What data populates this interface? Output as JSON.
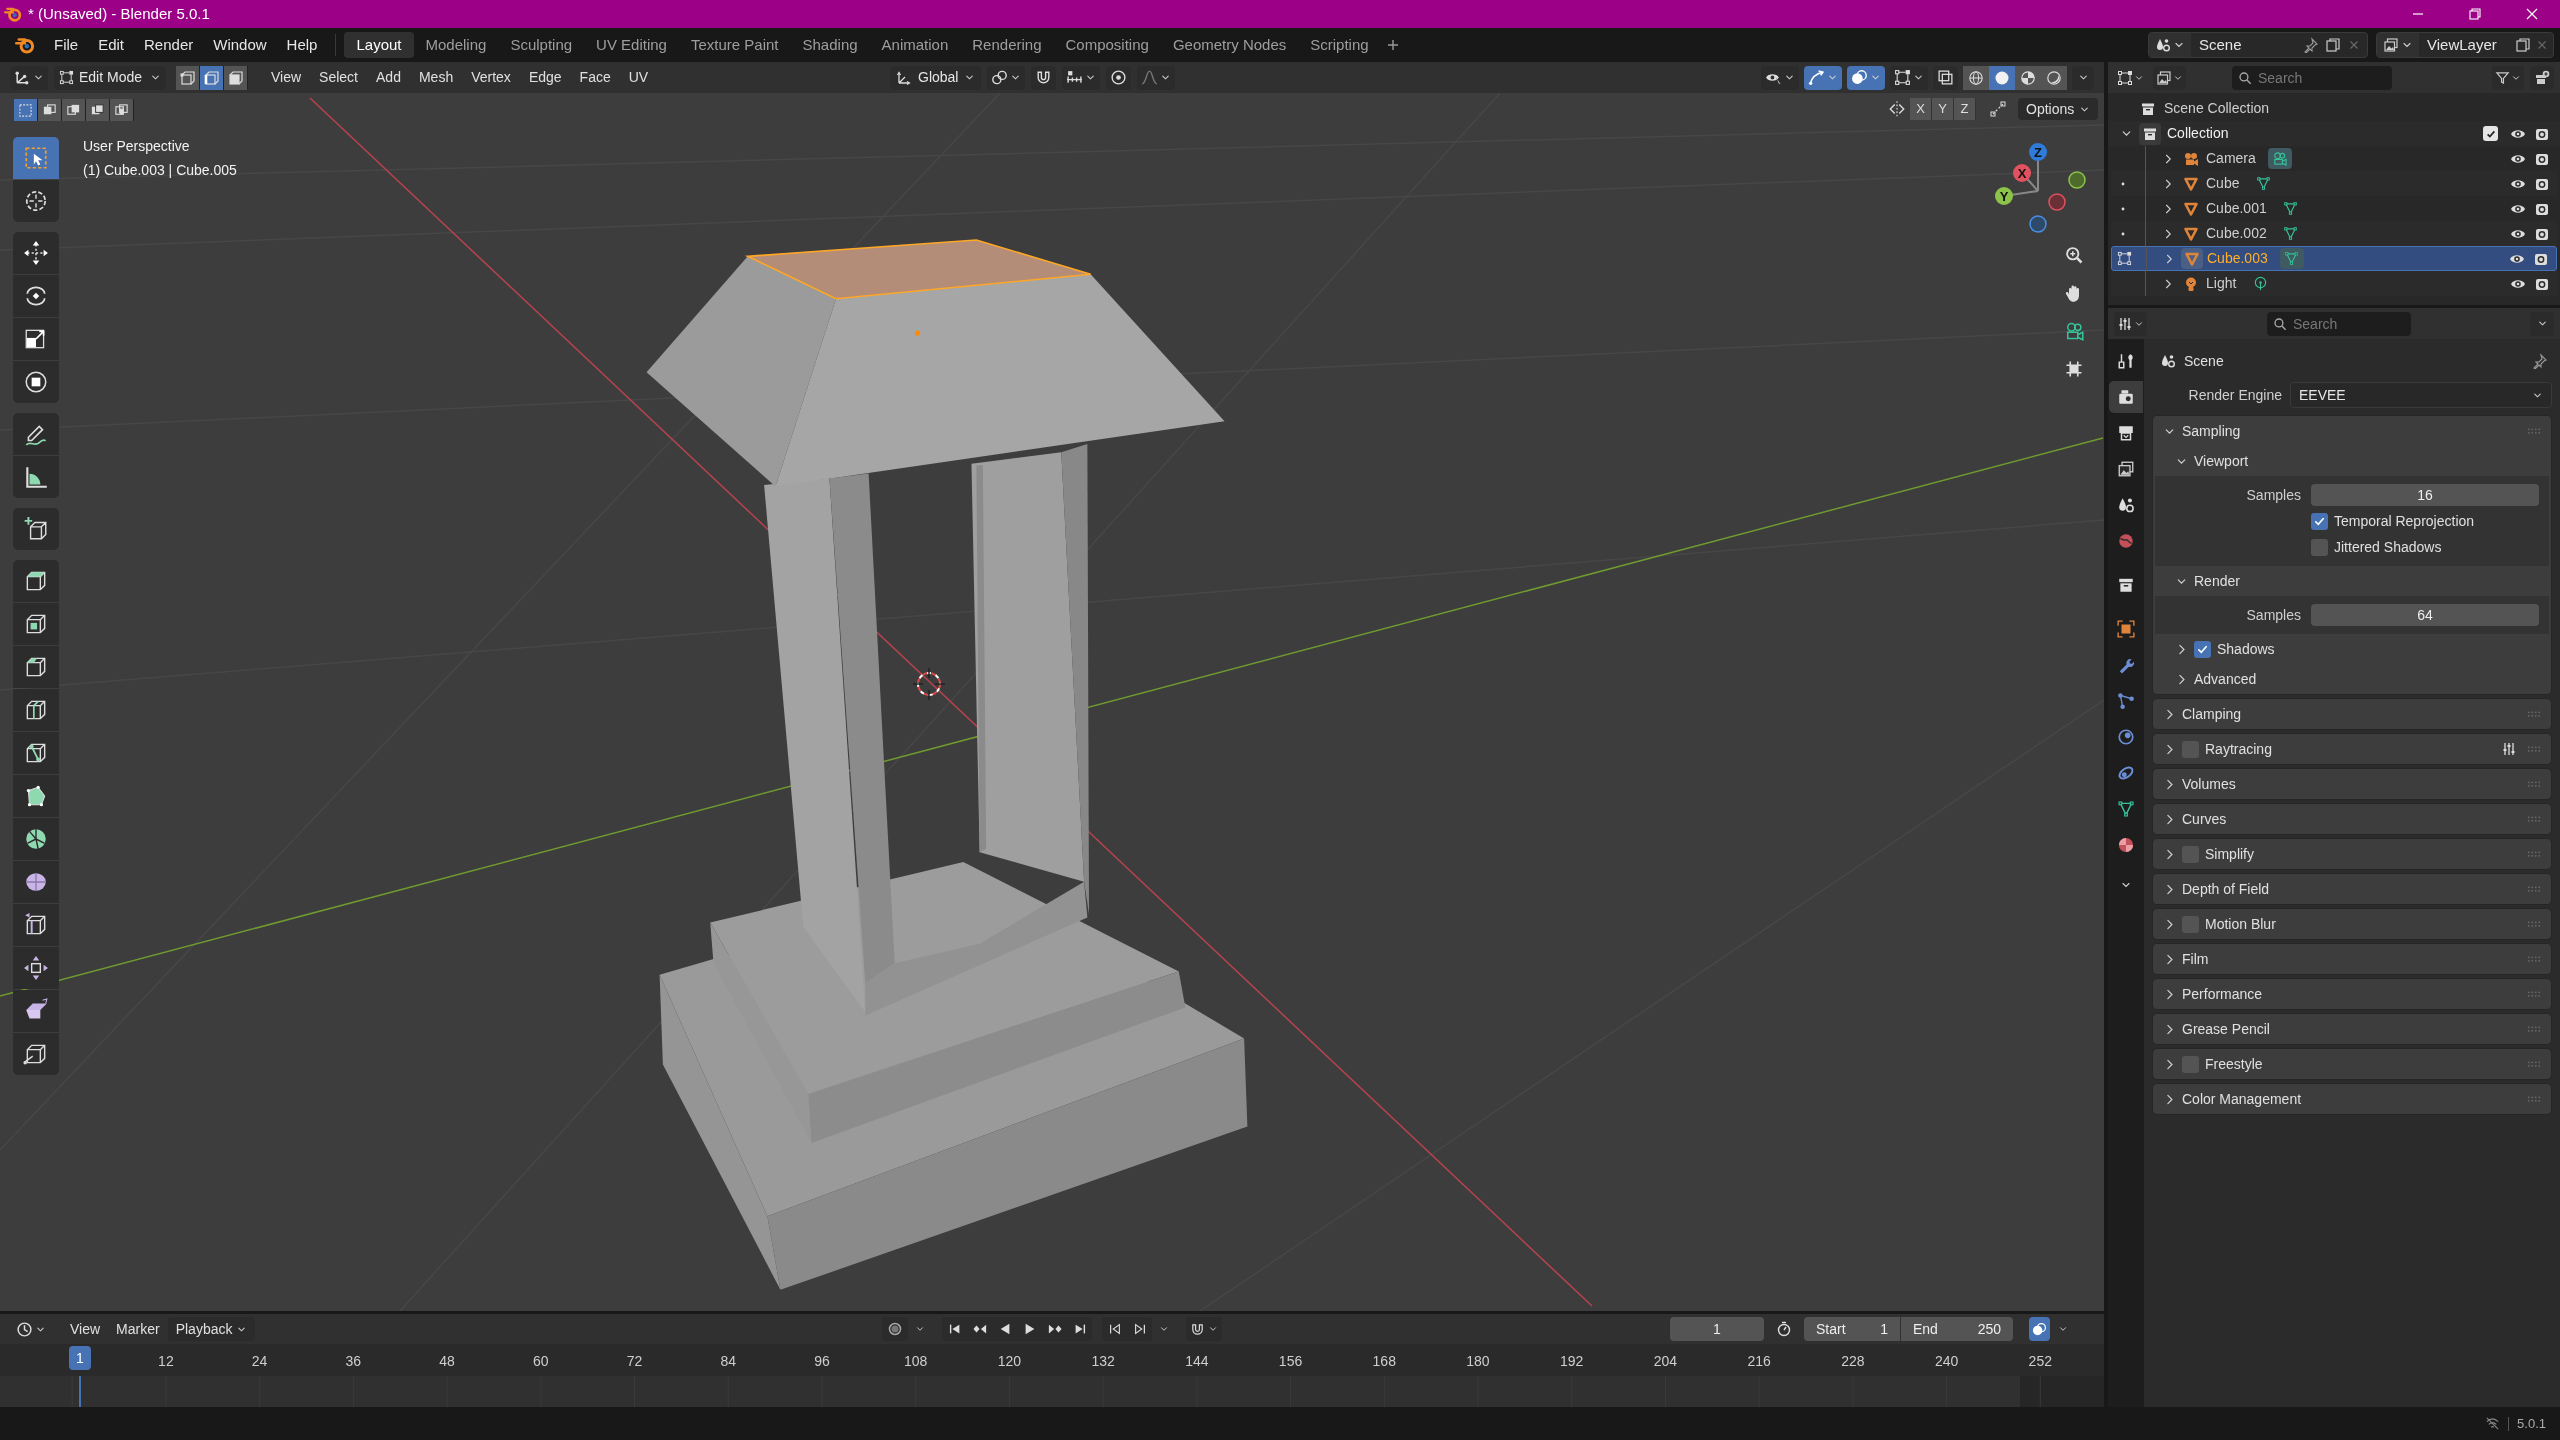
{
  "window": {
    "title": "* (Unsaved) - Blender 5.0.1"
  },
  "menu": [
    "File",
    "Edit",
    "Render",
    "Window",
    "Help"
  ],
  "workspaces": [
    {
      "label": "Layout",
      "selected": true
    },
    {
      "label": "Modeling",
      "selected": false
    },
    {
      "label": "Sculpting",
      "selected": false
    },
    {
      "label": "UV Editing",
      "selected": false
    },
    {
      "label": "Texture Paint",
      "selected": false
    },
    {
      "label": "Shading",
      "selected": false
    },
    {
      "label": "Animation",
      "selected": false
    },
    {
      "label": "Rendering",
      "selected": false
    },
    {
      "label": "Compositing",
      "selected": false
    },
    {
      "label": "Geometry Nodes",
      "selected": false
    },
    {
      "label": "Scripting",
      "selected": false
    }
  ],
  "scene": "Scene",
  "view_layer": "ViewLayer",
  "viewport": {
    "mode": "Edit Mode",
    "select_modes": [
      {
        "selected": false
      },
      {
        "selected": true
      },
      {
        "selected": false
      }
    ],
    "menus": [
      "View",
      "Select",
      "Add",
      "Mesh",
      "Vertex",
      "Edge",
      "Face",
      "UV"
    ],
    "orientation": "Global",
    "snap": false,
    "proportional_editing": false,
    "gizmos": true,
    "overlays": true,
    "xray": false,
    "shading": [
      {
        "selected": false
      },
      {
        "selected": true
      },
      {
        "selected": false
      },
      {
        "selected": false
      }
    ],
    "box_select_modes": [
      {
        "selected": true
      },
      {
        "selected": false
      },
      {
        "selected": false
      },
      {
        "selected": false
      },
      {
        "selected": false
      }
    ],
    "mirror_axes": [
      "X",
      "Y",
      "Z"
    ],
    "options": "Options",
    "view_name": "User Perspective",
    "object_info": "(1) Cube.003 | Cube.005",
    "gizmo_axes": [
      "X",
      "Y",
      "Z"
    ],
    "tool_groups": [
      [
        {
          "selected": true
        },
        {
          "selected": false
        }
      ],
      [
        {
          "selected": false
        },
        {
          "selected": false
        },
        {
          "selected": false
        },
        {
          "selected": false
        }
      ],
      [
        {
          "selected": false
        },
        {
          "selected": false
        }
      ],
      [
        {
          "selected": false
        }
      ],
      [
        {
          "selected": false
        },
        {
          "selected": false
        },
        {
          "selected": false
        },
        {
          "selected": false
        },
        {
          "selected": false
        },
        {
          "selected": false
        },
        {
          "selected": false
        },
        {
          "selected": false
        },
        {
          "selected": false
        },
        {
          "selected": false
        },
        {
          "selected": false
        },
        {
          "selected": false
        }
      ]
    ]
  },
  "outliner": {
    "search_placeholder": "Search",
    "root": "Scene Collection",
    "collection": {
      "name": "Collection",
      "expanded": true,
      "checked": true,
      "items": [
        {
          "name": "Camera",
          "kind": "camera",
          "selected": false,
          "editable": false,
          "editing": false
        },
        {
          "name": "Cube",
          "kind": "mesh",
          "selected": false,
          "editable": true,
          "editing": false
        },
        {
          "name": "Cube.001",
          "kind": "mesh",
          "selected": false,
          "editable": true,
          "editing": false
        },
        {
          "name": "Cube.002",
          "kind": "mesh",
          "selected": false,
          "editable": true,
          "editing": false
        },
        {
          "name": "Cube.003",
          "kind": "mesh",
          "selected": true,
          "editable": true,
          "editing": true
        },
        {
          "name": "Light",
          "kind": "light",
          "selected": false,
          "editable": false,
          "editing": false
        }
      ]
    }
  },
  "properties": {
    "search_placeholder": "Search",
    "tabs": [
      {
        "selected": false
      },
      {
        "selected": true
      },
      {
        "selected": false
      },
      {
        "selected": false
      },
      {
        "selected": false
      },
      {
        "selected": false
      },
      {
        "selected": false
      },
      {
        "selected": false
      },
      {
        "selected": false
      },
      {
        "selected": false
      },
      {
        "selected": false
      },
      {
        "selected": false
      },
      {
        "selected": false
      },
      {
        "selected": false
      }
    ],
    "context": "Scene",
    "render_engine_label": "Render Engine",
    "render_engine": "EEVEE",
    "panels": [
      {
        "title": "Sampling",
        "expanded": true,
        "subpanels": [
          {
            "title": "Viewport",
            "expanded": true,
            "fields": [
              {
                "kind": "number",
                "label": "Samples",
                "value": "16"
              },
              {
                "kind": "checkbox",
                "label": "Temporal Reprojection",
                "checked": true
              },
              {
                "kind": "checkbox",
                "label": "Jittered Shadows",
                "checked": false
              }
            ]
          },
          {
            "title": "Render",
            "expanded": true,
            "fields": [
              {
                "kind": "number",
                "label": "Samples",
                "value": "64"
              }
            ]
          },
          {
            "title": "Shadows",
            "expanded": false,
            "checked": true
          },
          {
            "title": "Advanced",
            "expanded": false
          }
        ]
      },
      {
        "title": "Clamping",
        "expanded": false
      },
      {
        "title": "Raytracing",
        "expanded": false,
        "checked": false,
        "options_icon": true
      },
      {
        "title": "Volumes",
        "expanded": false
      },
      {
        "title": "Curves",
        "expanded": false
      },
      {
        "title": "Simplify",
        "expanded": false,
        "checked": false
      },
      {
        "title": "Depth of Field",
        "expanded": false
      },
      {
        "title": "Motion Blur",
        "expanded": false,
        "checked": false
      },
      {
        "title": "Film",
        "expanded": false
      },
      {
        "title": "Performance",
        "expanded": false
      },
      {
        "title": "Grease Pencil",
        "expanded": false
      },
      {
        "title": "Freestyle",
        "expanded": false,
        "checked": false
      },
      {
        "title": "Color Management",
        "expanded": false
      }
    ]
  },
  "timeline": {
    "menus": [
      "View",
      "Marker",
      "Playback"
    ],
    "auto_keying": false,
    "current_frame": "1",
    "start_label": "Start",
    "start": "1",
    "end_label": "End",
    "end": "250",
    "playhead": "1",
    "ruler_labels": [
      "12",
      "24",
      "36",
      "48",
      "60",
      "72",
      "84",
      "96",
      "108",
      "120",
      "132",
      "144",
      "156",
      "168",
      "180",
      "192",
      "204",
      "216",
      "228",
      "240",
      "252"
    ]
  },
  "status_bar": {
    "version": "5.0.1"
  }
}
